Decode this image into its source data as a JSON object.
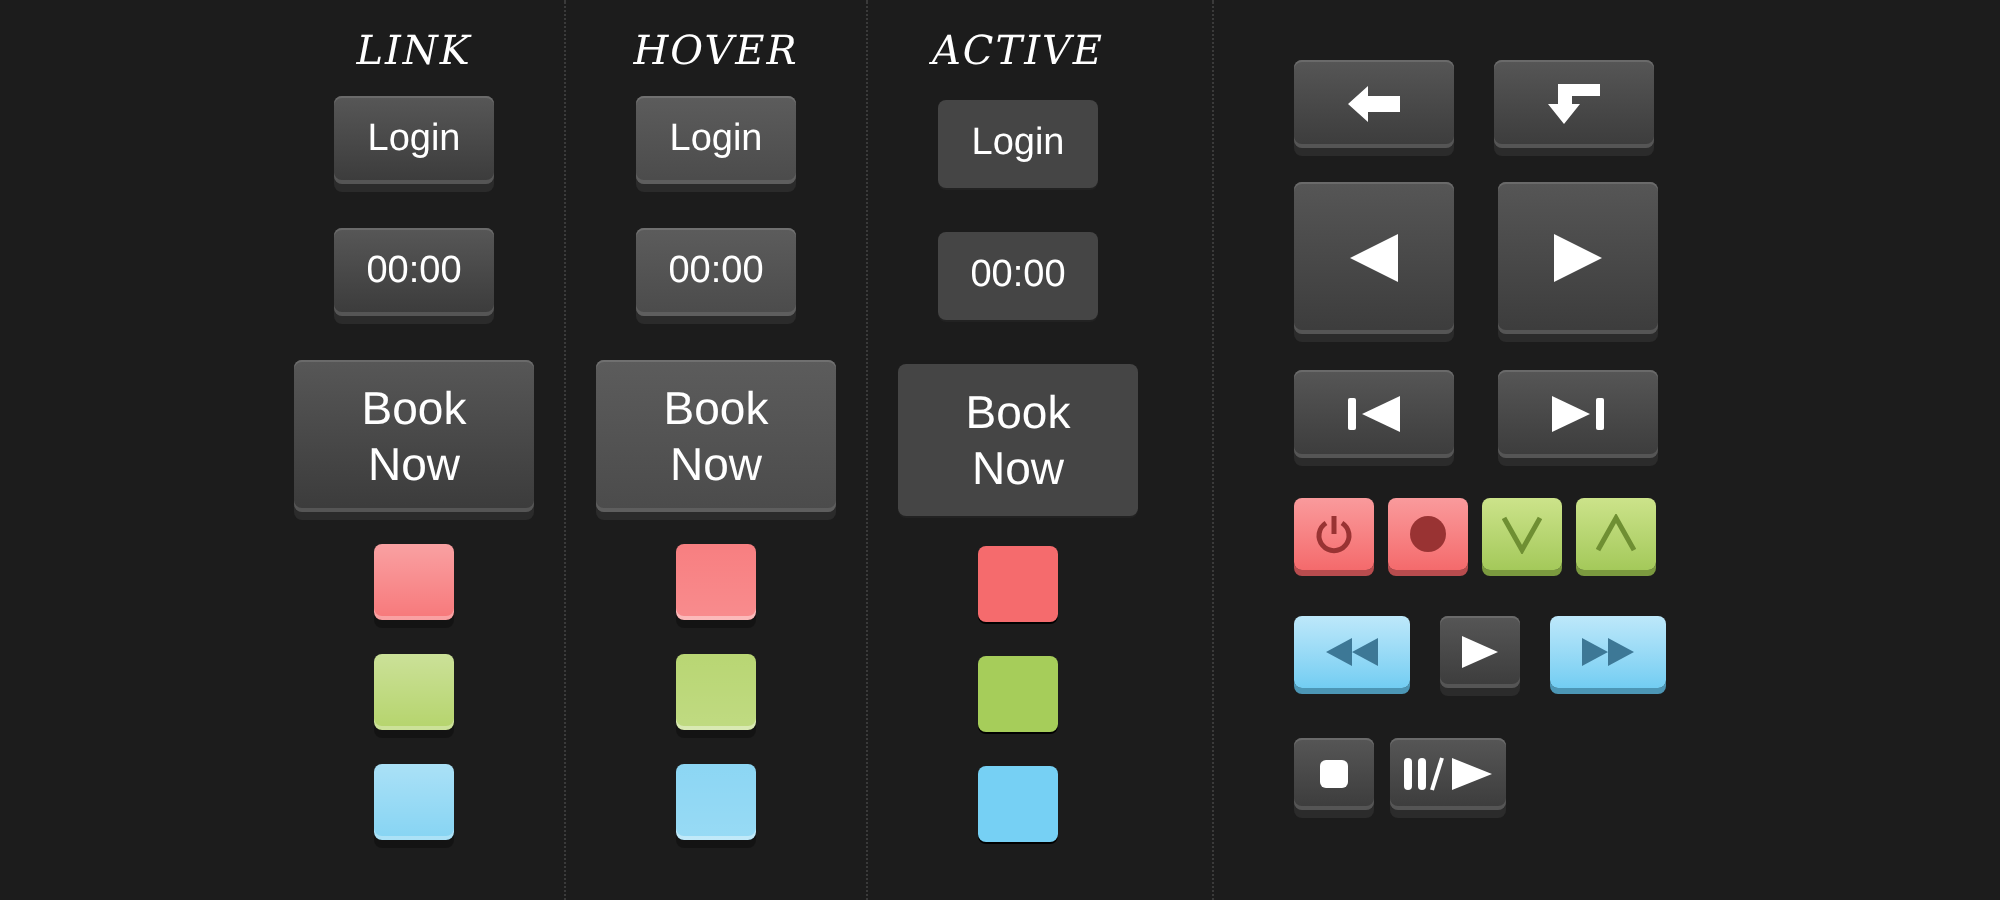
{
  "columns": [
    {
      "heading": "LINK",
      "kind": "link",
      "buttons": [
        {
          "label": "Login",
          "kind": "small"
        },
        {
          "label": "00:00",
          "kind": "small"
        },
        {
          "label": "Book Now",
          "kind": "large"
        }
      ],
      "swatches": [
        {
          "color": "#f7787a"
        },
        {
          "color": "#b5d46c"
        },
        {
          "color": "#86d4f3"
        }
      ]
    },
    {
      "heading": "HOVER",
      "kind": "hover",
      "buttons": [
        {
          "label": "Login",
          "kind": "small"
        },
        {
          "label": "00:00",
          "kind": "small"
        },
        {
          "label": "Book Now",
          "kind": "large"
        }
      ],
      "swatches": [
        {
          "color": "#f7787a"
        },
        {
          "color": "#b5d46c"
        },
        {
          "color": "#86d4f3"
        }
      ]
    },
    {
      "heading": "ACTIVE",
      "kind": "active",
      "buttons": [
        {
          "label": "Login",
          "kind": "small"
        },
        {
          "label": "00:00",
          "kind": "small"
        },
        {
          "label": "Book Now",
          "kind": "large"
        }
      ],
      "swatches": [
        {
          "color": "#f56b6d"
        },
        {
          "color": "#a6cd5a"
        },
        {
          "color": "#76d0f4"
        }
      ]
    }
  ]
}
